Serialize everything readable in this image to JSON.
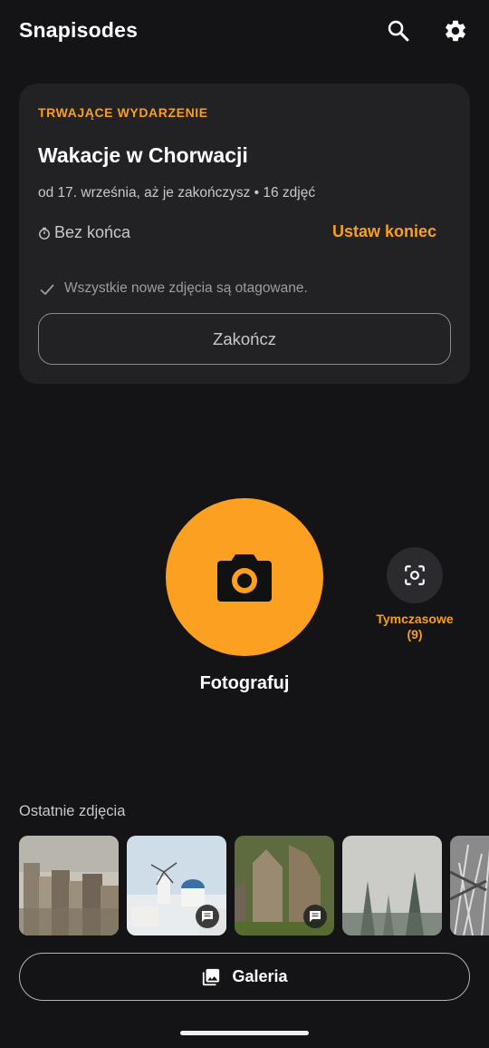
{
  "app": {
    "title": "Snapisodes"
  },
  "topbar": {
    "search_icon": "search-icon",
    "settings_icon": "gear-icon"
  },
  "event": {
    "overline": "TRWAJĄCE WYDARZENIE",
    "title": "Wakacje w Chorwacji",
    "meta": "od 17. września, aż je zakończysz • 16 zdjęć",
    "end_label": "Bez końca",
    "set_end": "Ustaw koniec",
    "tag_note": "Wszystkie nowe zdjęcia są otagowane.",
    "finish": "Zakończ"
  },
  "capture": {
    "label": "Fotografuj",
    "temp_label": "Tymczasowe",
    "temp_count": "(9)"
  },
  "recent": {
    "title": "Ostatnie zdjęcia",
    "photos": [
      {
        "subject": "city skyline",
        "has_note": false
      },
      {
        "subject": "santorini windmill",
        "has_note": true
      },
      {
        "subject": "rock formations",
        "has_note": true
      },
      {
        "subject": "foggy forest",
        "has_note": false
      },
      {
        "subject": "grass closeup",
        "has_note": false
      }
    ]
  },
  "gallery": {
    "label": "Galeria"
  },
  "colors": {
    "accent": "#F6A01F",
    "shutter": "#FCA021",
    "background": "#141315",
    "card": "#222124"
  }
}
